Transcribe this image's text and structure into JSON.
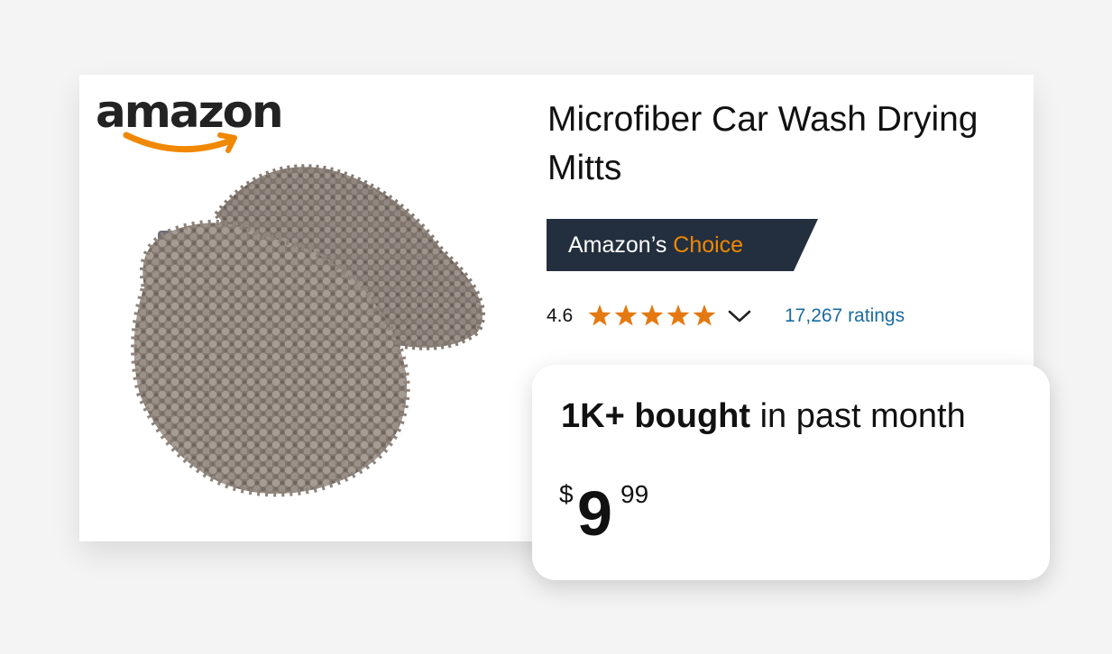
{
  "brand": {
    "logo_text": "amazon",
    "accent_color": "#f08804"
  },
  "product": {
    "title": "Microfiber Car Wash Drying Mitts",
    "image_icon": "microfiber-mitt-image"
  },
  "badge": {
    "prefix": "Amazon’s ",
    "accent": "Choice",
    "background_color": "#232f3e"
  },
  "rating": {
    "value": "4.6",
    "stars_value": 4.6,
    "stars_max": 5,
    "star_color": "#e47911",
    "ratings_count_label": "17,267 ratings",
    "chevron_icon": "chevron-down-icon"
  },
  "purchase": {
    "bought_bold": "1K+ bought",
    "bought_rest": " in past month",
    "price_currency": "$",
    "price_whole": "9",
    "price_fraction": "99"
  }
}
